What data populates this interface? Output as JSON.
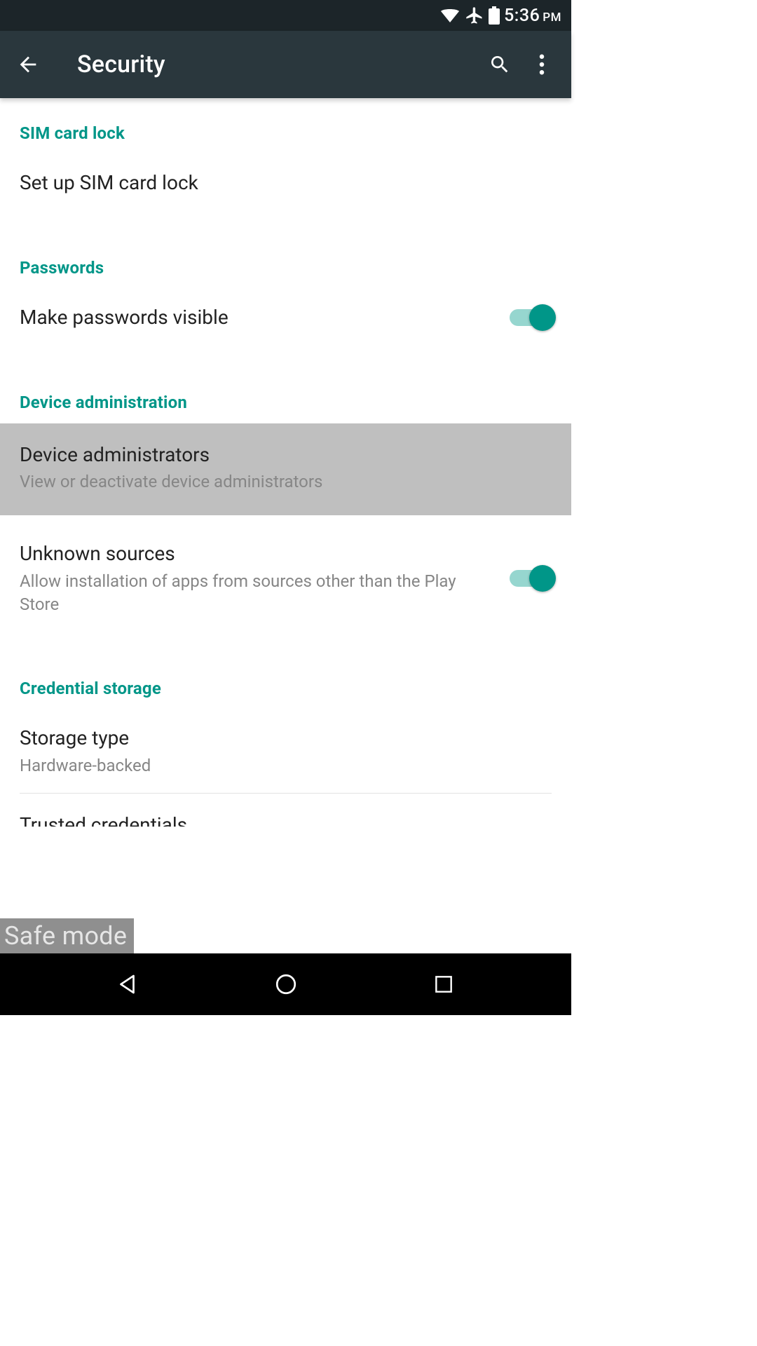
{
  "status": {
    "time": "5:36",
    "ampm": "PM"
  },
  "appbar": {
    "title": "Security"
  },
  "sections": {
    "sim": {
      "header": "SIM card lock",
      "setup": "Set up SIM card lock"
    },
    "passwords": {
      "header": "Passwords",
      "visible_title": "Make passwords visible",
      "visible_on": true
    },
    "device_admin": {
      "header": "Device administration",
      "admins_title": "Device administrators",
      "admins_sub": "View or deactivate device administrators",
      "unknown_title": "Unknown sources",
      "unknown_sub": "Allow installation of apps from sources other than the Play Store",
      "unknown_on": true
    },
    "cred": {
      "header": "Credential storage",
      "storage_title": "Storage type",
      "storage_sub": "Hardware-backed",
      "trusted_title": "Trusted credentials"
    }
  },
  "overlay": {
    "safe_mode": "Safe mode"
  }
}
